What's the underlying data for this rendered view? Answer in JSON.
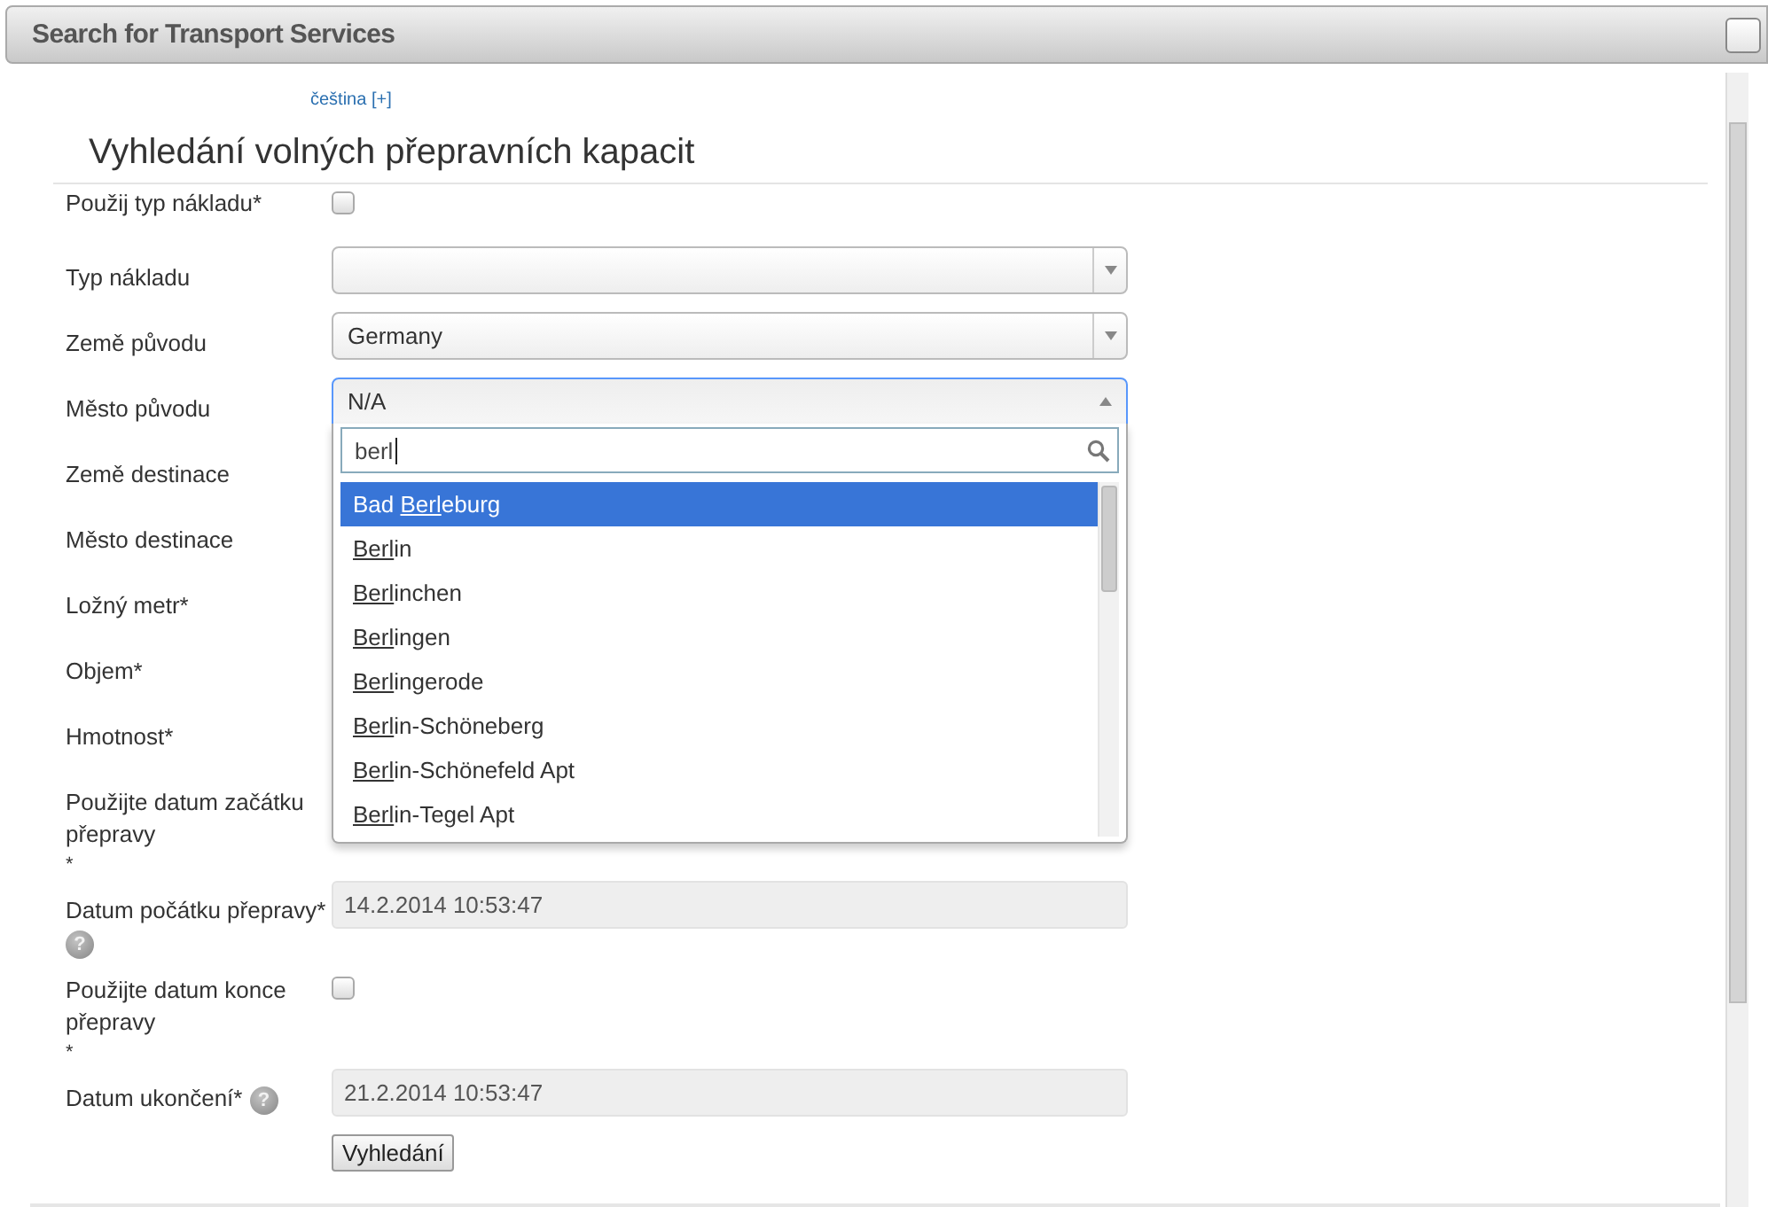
{
  "panel": {
    "title": "Search for Transport Services"
  },
  "language_link": "čeština [+]",
  "heading": "Vyhledání volných přepravních kapacit",
  "rows": [
    {
      "label": "Použij typ nákladu*",
      "kind": "checkbox",
      "checked": false
    },
    {
      "label": "Typ nákladu",
      "kind": "select",
      "value": ""
    },
    {
      "label": "Země původu",
      "kind": "select",
      "value": "Germany"
    },
    {
      "label": "Město původu",
      "kind": "select-open",
      "value": "N/A"
    },
    {
      "label": "Země destinace",
      "kind": "hidden"
    },
    {
      "label": "Město destinace",
      "kind": "hidden"
    },
    {
      "label": "Ložný metr*",
      "kind": "hidden"
    },
    {
      "label": "Objem*",
      "kind": "hidden"
    },
    {
      "label": "Hmotnost*",
      "kind": "hidden"
    },
    {
      "label": "Použijte datum začátku přepravy",
      "note": "*",
      "kind": "hidden"
    },
    {
      "label": "Datum počátku přepravy*",
      "kind": "date",
      "help": "?",
      "help_below": true,
      "value": "14.2.2014 10:53:47"
    },
    {
      "label": "Použijte datum konce přepravy",
      "note": "*",
      "kind": "checkbox",
      "checked": false
    },
    {
      "label": "Datum ukončení*",
      "kind": "date",
      "help": "?",
      "help_below": false,
      "value": "21.2.2014 10:53:47"
    }
  ],
  "dropdown": {
    "search": "berl",
    "options": [
      {
        "before": "Bad ",
        "match": "Berl",
        "after": "eburg",
        "selected": true
      },
      {
        "match": "Berl",
        "after": "in",
        "selected": false
      },
      {
        "match": "Berl",
        "after": "inchen",
        "selected": false
      },
      {
        "match": "Berl",
        "after": "ingen",
        "selected": false
      },
      {
        "match": "Berl",
        "after": "ingerode",
        "selected": false
      },
      {
        "match": "Berl",
        "after": "in-Schöneberg",
        "selected": false
      },
      {
        "match": "Berl",
        "after": "in-Schönefeld Apt",
        "selected": false
      },
      {
        "match": "Berl",
        "after": "in-Tegel Apt",
        "selected": false
      }
    ]
  },
  "submit": "Vyhledání"
}
